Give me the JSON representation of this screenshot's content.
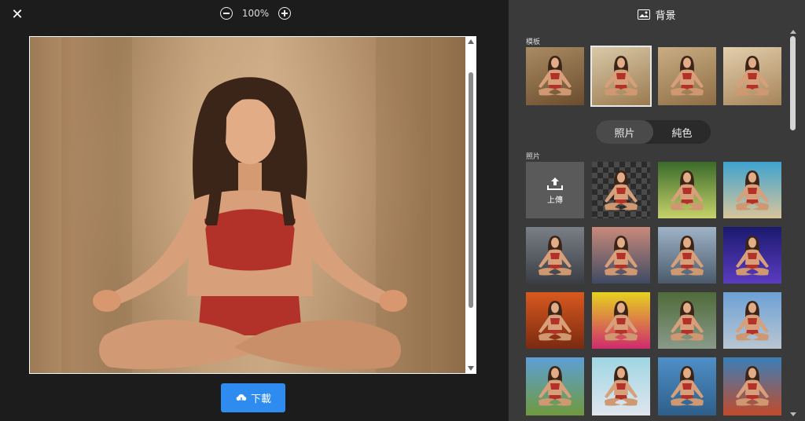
{
  "toolbar": {
    "zoom_level": "100%"
  },
  "download_label": "下載",
  "panel": {
    "title": "背景",
    "template_label": "模板",
    "toggle": {
      "photo": "照片",
      "solid": "純色"
    },
    "photos_label": "照片",
    "upload_label": "上傳"
  },
  "templates": [
    {
      "name": "ornate-frame",
      "bg": [
        "#a98c63",
        "#6b4d2e"
      ]
    },
    {
      "name": "carved-panel",
      "bg": [
        "#d9c9a8",
        "#9b7a4f"
      ],
      "selected": true
    },
    {
      "name": "paper-frame",
      "bg": [
        "#c9ad83",
        "#8e6d45"
      ]
    },
    {
      "name": "vignette",
      "bg": [
        "#e3cfae",
        "#a68458"
      ]
    }
  ],
  "photo_tiles": [
    {
      "name": "transparent",
      "bg": [
        "#444",
        "#555"
      ]
    },
    {
      "name": "forest",
      "bg": [
        "#3a6b2a",
        "#c7d26a"
      ]
    },
    {
      "name": "beach",
      "bg": [
        "#3ea3cf",
        "#d9c59a"
      ]
    },
    {
      "name": "city-street",
      "bg": [
        "#7a7f87",
        "#3a3d44"
      ]
    },
    {
      "name": "sunset-city",
      "bg": [
        "#c98a7a",
        "#3e4a63"
      ]
    },
    {
      "name": "skyline",
      "bg": [
        "#9fb3c7",
        "#4a5a6b"
      ]
    },
    {
      "name": "space",
      "bg": [
        "#1b1a6e",
        "#5b3cc1"
      ]
    },
    {
      "name": "autumn",
      "bg": [
        "#d9591f",
        "#7a2a10"
      ]
    },
    {
      "name": "rainbow",
      "bg": [
        "#e6d21f",
        "#cf2a6d"
      ]
    },
    {
      "name": "road-forest",
      "bg": [
        "#4f6b3a",
        "#8a9a8a"
      ]
    },
    {
      "name": "lake",
      "bg": [
        "#6da1d6",
        "#b9c6d1"
      ]
    },
    {
      "name": "mountains",
      "bg": [
        "#5d9fd6",
        "#6f9a3d"
      ]
    },
    {
      "name": "bokeh",
      "bg": [
        "#9fd6e3",
        "#e0e6ee"
      ]
    },
    {
      "name": "sea",
      "bg": [
        "#4f8fc7",
        "#2e5f8a"
      ]
    },
    {
      "name": "bridge",
      "bg": [
        "#3a7fb8",
        "#c24a2a"
      ]
    }
  ]
}
